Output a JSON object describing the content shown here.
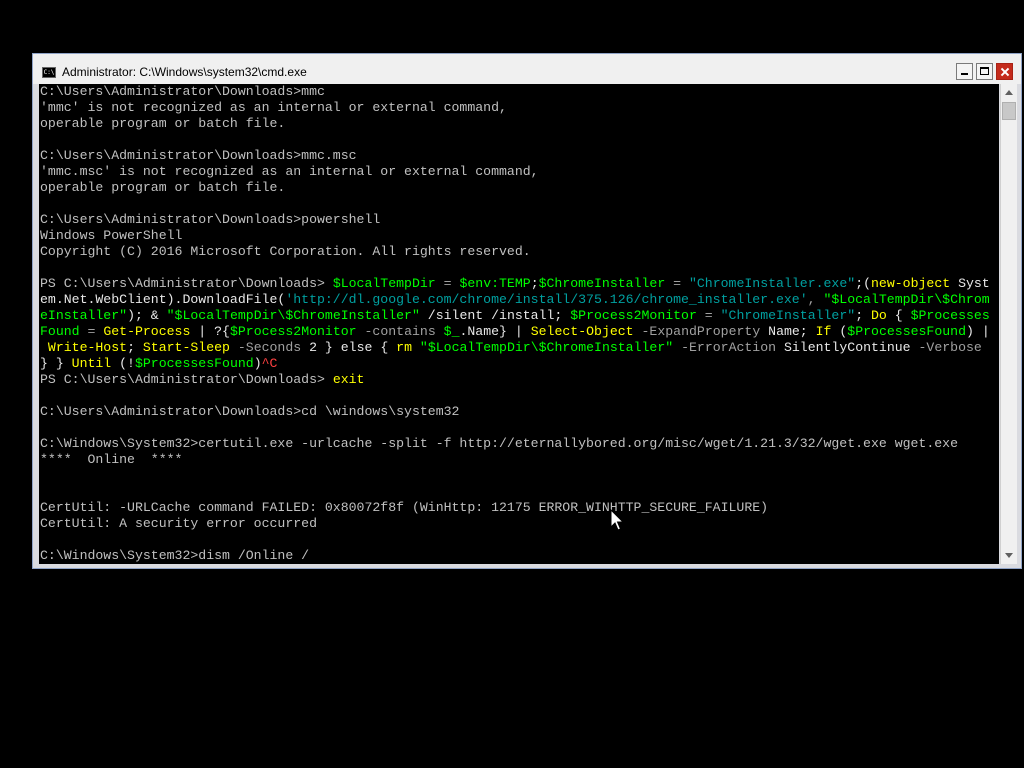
{
  "window": {
    "title": "Administrator: C:\\Windows\\system32\\cmd.exe",
    "icon": "cmd-icon"
  },
  "console": {
    "lines": [
      [
        {
          "t": "C:\\Users\\Administrator\\Downloads>mmc"
        }
      ],
      [
        {
          "t": "'mmc' is not recognized as an internal or external command,"
        }
      ],
      [
        {
          "t": "operable program or batch file."
        }
      ],
      [
        {
          "t": ""
        }
      ],
      [
        {
          "t": "C:\\Users\\Administrator\\Downloads>mmc.msc"
        }
      ],
      [
        {
          "t": "'mmc.msc' is not recognized as an internal or external command,"
        }
      ],
      [
        {
          "t": "operable program or batch file."
        }
      ],
      [
        {
          "t": ""
        }
      ],
      [
        {
          "t": "C:\\Users\\Administrator\\Downloads>powershell"
        }
      ],
      [
        {
          "t": "Windows PowerShell"
        }
      ],
      [
        {
          "t": "Copyright (C) 2016 Microsoft Corporation. All rights reserved."
        }
      ],
      [
        {
          "t": ""
        }
      ],
      [
        {
          "t": "PS C:\\Users\\Administrator\\Downloads> "
        },
        {
          "t": "$LocalTempDir",
          "c": "g"
        },
        {
          "t": " = ",
          "c": "gr"
        },
        {
          "t": "$env:TEMP",
          "c": "g"
        },
        {
          "t": ";",
          "c": "w"
        },
        {
          "t": "$ChromeInstaller",
          "c": "g"
        },
        {
          "t": " = ",
          "c": "gr"
        },
        {
          "t": "\"ChromeInstaller.exe\"",
          "c": "c"
        },
        {
          "t": ";(",
          "c": "w"
        },
        {
          "t": "new-object",
          "c": "y"
        },
        {
          "t": " Syst",
          "c": "w"
        }
      ],
      [
        {
          "t": "em.Net.WebClient).DownloadFile(",
          "c": "w"
        },
        {
          "t": "'http://dl.google.com/chrome/install/375.126/chrome_installer.exe'",
          "c": "c"
        },
        {
          "t": ", ",
          "c": "gr"
        },
        {
          "t": "\"$LocalTempDir\\$Chrom",
          "c": "g"
        }
      ],
      [
        {
          "t": "eInstaller\"",
          "c": "g"
        },
        {
          "t": "); & ",
          "c": "w"
        },
        {
          "t": "\"$LocalTempDir\\$ChromeInstaller\"",
          "c": "g"
        },
        {
          "t": " /silent /install; ",
          "c": "w"
        },
        {
          "t": "$Process2Monitor",
          "c": "g"
        },
        {
          "t": " = ",
          "c": "gr"
        },
        {
          "t": "\"ChromeInstaller\"",
          "c": "c"
        },
        {
          "t": "; ",
          "c": "w"
        },
        {
          "t": "Do",
          "c": "y"
        },
        {
          "t": " { ",
          "c": "w"
        },
        {
          "t": "$Processes",
          "c": "g"
        }
      ],
      [
        {
          "t": "Found",
          "c": "g"
        },
        {
          "t": " = ",
          "c": "gr"
        },
        {
          "t": "Get-Process",
          "c": "y"
        },
        {
          "t": " | ?{",
          "c": "w"
        },
        {
          "t": "$Process2Monitor",
          "c": "g"
        },
        {
          "t": " -contains ",
          "c": "gr"
        },
        {
          "t": "$_",
          "c": "g"
        },
        {
          "t": ".Name} | ",
          "c": "w"
        },
        {
          "t": "Select-Object",
          "c": "y"
        },
        {
          "t": " -ExpandProperty ",
          "c": "gr"
        },
        {
          "t": "Name; ",
          "c": "w"
        },
        {
          "t": "If",
          "c": "y"
        },
        {
          "t": " (",
          "c": "w"
        },
        {
          "t": "$ProcessesFound",
          "c": "g"
        },
        {
          "t": ") |",
          "c": "w"
        }
      ],
      [
        {
          "t": " Write-Host",
          "c": "y"
        },
        {
          "t": "; ",
          "c": "w"
        },
        {
          "t": "Start-Sleep",
          "c": "y"
        },
        {
          "t": " -Seconds ",
          "c": "gr"
        },
        {
          "t": "2",
          "c": "w"
        },
        {
          "t": " } ",
          "c": "w"
        },
        {
          "t": "else",
          "c": "w"
        },
        {
          "t": " { ",
          "c": "w"
        },
        {
          "t": "rm",
          "c": "y"
        },
        {
          "t": " ",
          "c": "w"
        },
        {
          "t": "\"$LocalTempDir\\$ChromeInstaller\"",
          "c": "g"
        },
        {
          "t": " -ErrorAction ",
          "c": "gr"
        },
        {
          "t": "SilentlyContinue",
          "c": "w"
        },
        {
          "t": " -Verbose",
          "c": "gr"
        }
      ],
      [
        {
          "t": "} } ",
          "c": "w"
        },
        {
          "t": "Until",
          "c": "y"
        },
        {
          "t": " (!",
          "c": "w"
        },
        {
          "t": "$ProcessesFound",
          "c": "g"
        },
        {
          "t": ")",
          "c": "w"
        },
        {
          "t": "^C",
          "c": "r"
        }
      ],
      [
        {
          "t": "PS C:\\Users\\Administrator\\Downloads> "
        },
        {
          "t": "exit",
          "c": "y"
        }
      ],
      [
        {
          "t": ""
        }
      ],
      [
        {
          "t": "C:\\Users\\Administrator\\Downloads>cd \\windows\\system32"
        }
      ],
      [
        {
          "t": ""
        }
      ],
      [
        {
          "t": "C:\\Windows\\System32>certutil.exe -urlcache -split -f http://eternallybored.org/misc/wget/1.21.3/32/wget.exe wget.exe"
        }
      ],
      [
        {
          "t": "****  Online  ****"
        }
      ],
      [
        {
          "t": ""
        }
      ],
      [
        {
          "t": ""
        }
      ],
      [
        {
          "t": "CertUtil: -URLCache command FAILED: 0x80072f8f (WinHttp: 12175 ERROR_WINHTTP_SECURE_FAILURE)"
        }
      ],
      [
        {
          "t": "CertUtil: A security error occurred"
        }
      ],
      [
        {
          "t": ""
        }
      ],
      [
        {
          "t": "C:\\Windows\\System32>dism /Online /"
        }
      ]
    ]
  },
  "colors": {
    "console_bg": "#000000",
    "console_text": "#c0c0c0",
    "keyword": "#ffff00",
    "variable": "#00ff00",
    "string": "#00a0a0",
    "error": "#ff4040",
    "close_button": "#c42b1c"
  }
}
